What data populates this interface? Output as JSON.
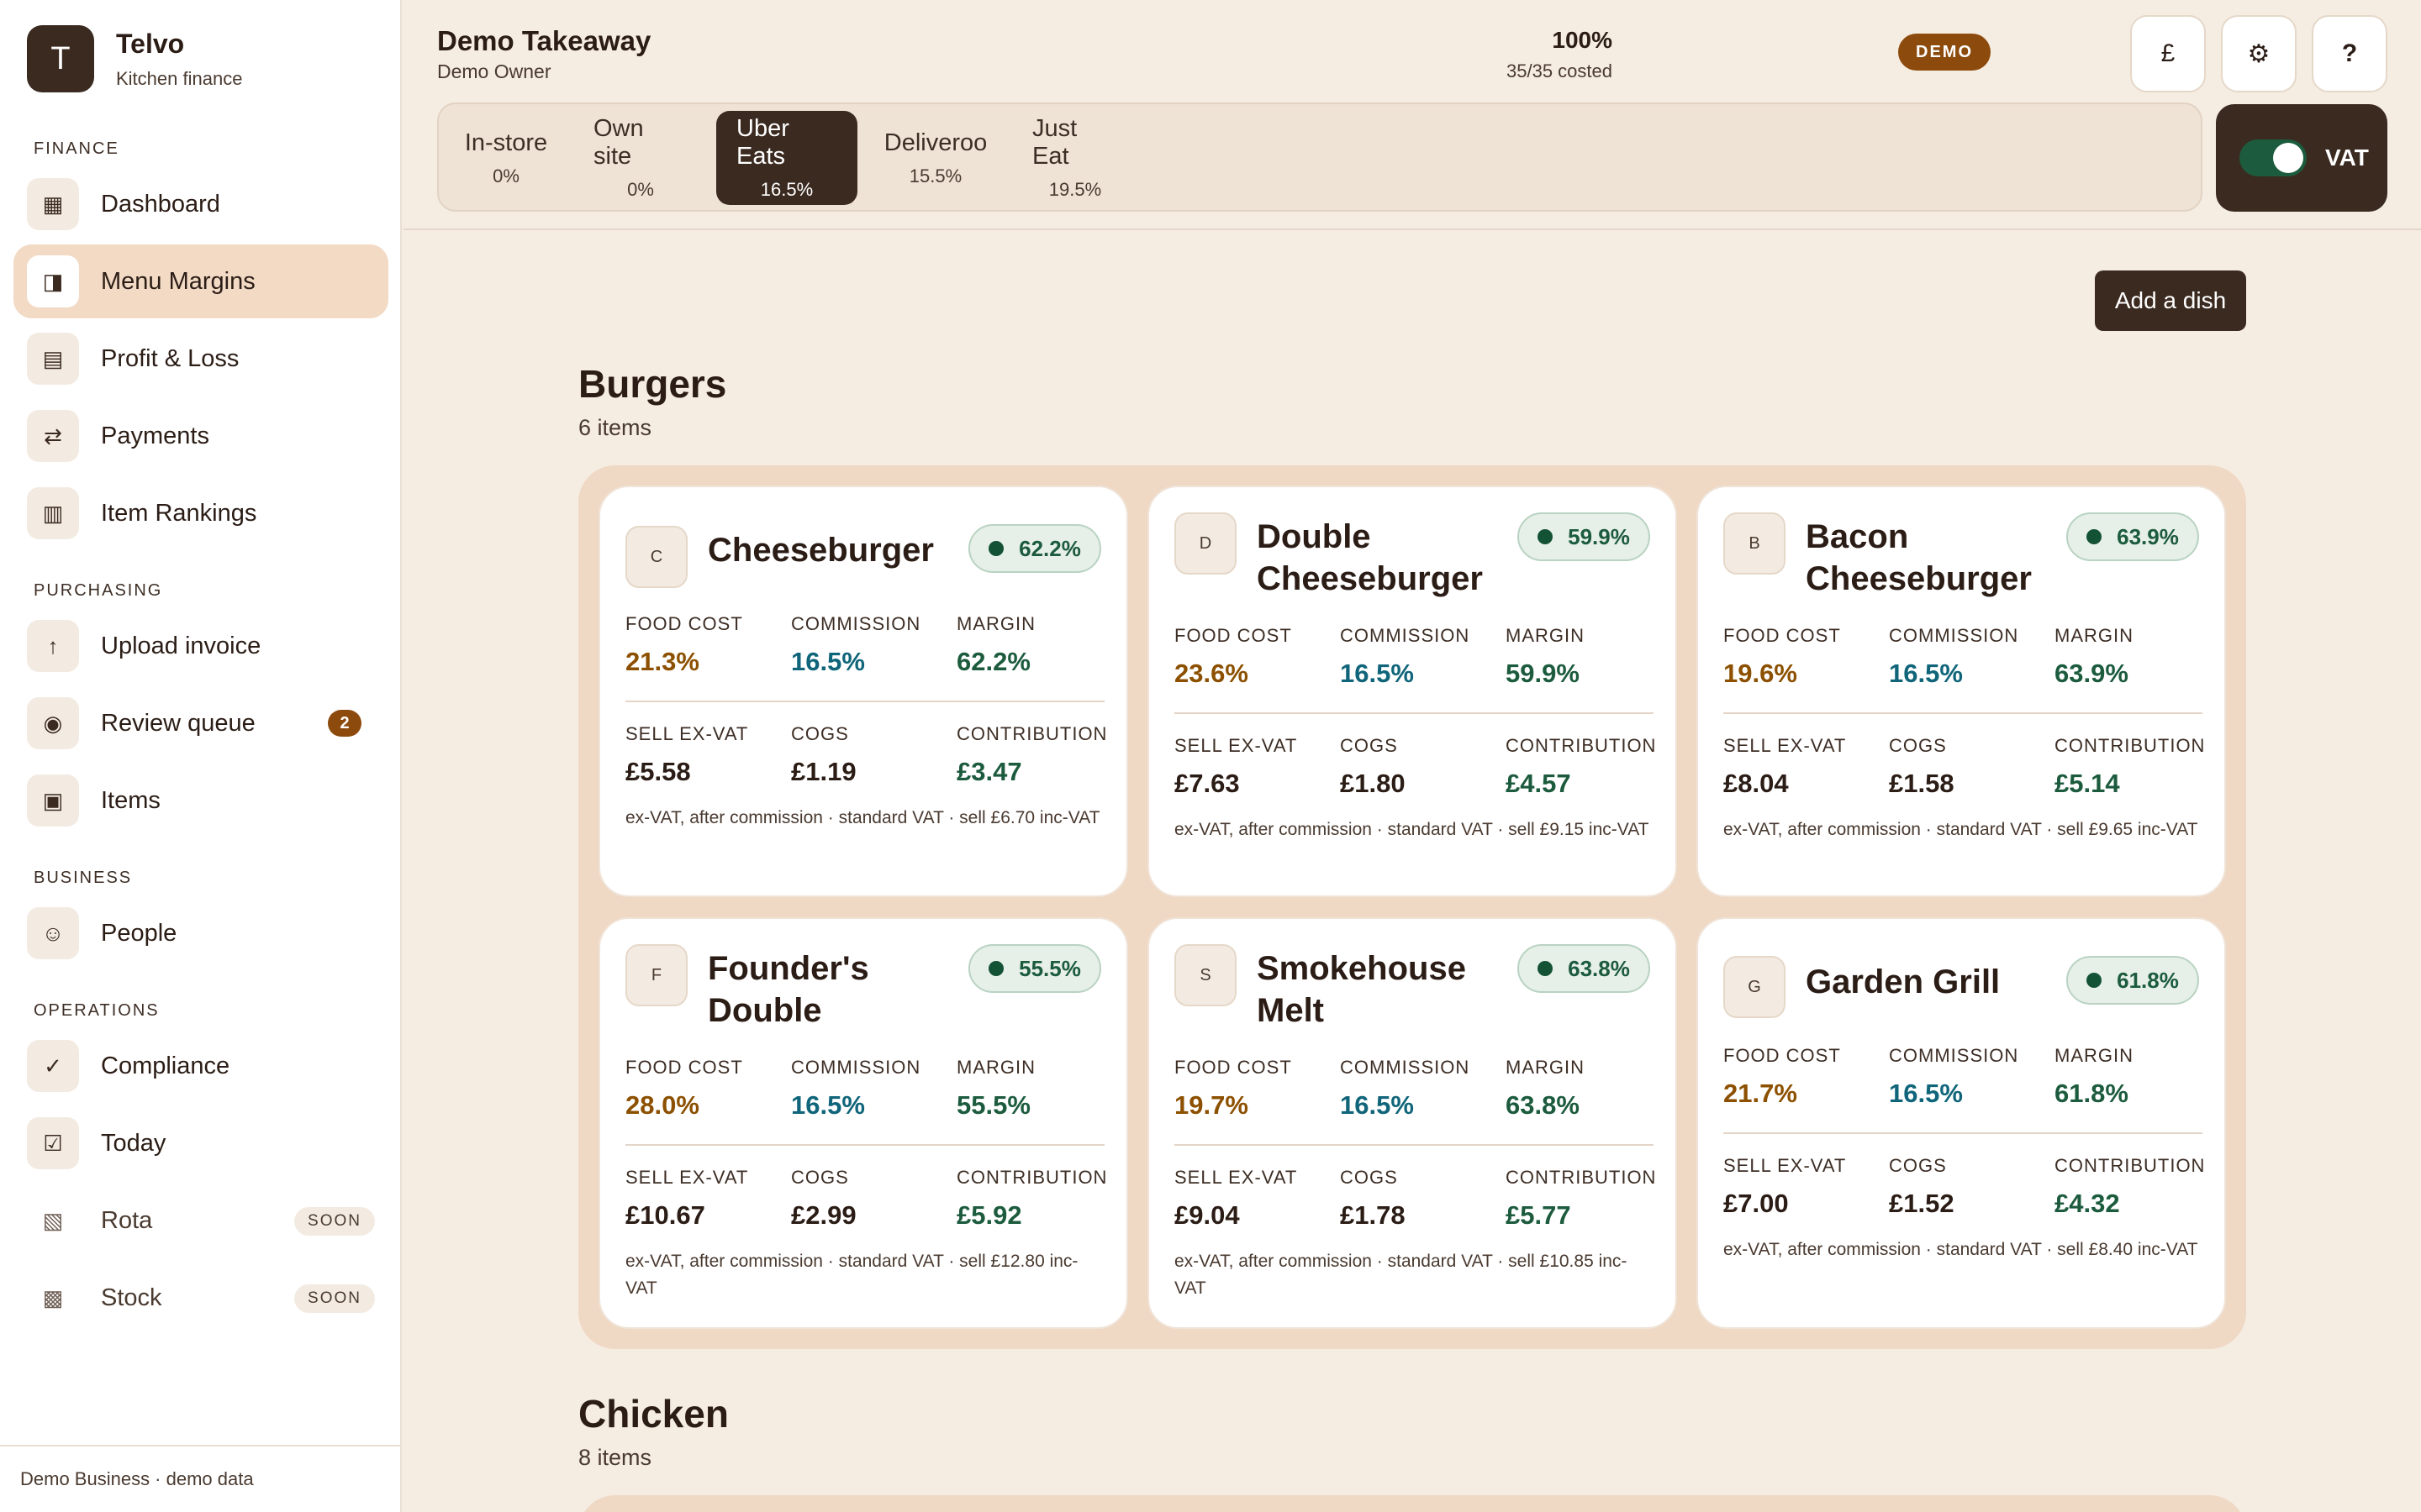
{
  "brand": {
    "initial": "T",
    "name": "Telvo",
    "subtitle": "Kitchen finance"
  },
  "sidebar": {
    "sections": {
      "finance": "FINANCE",
      "purchasing": "PURCHASING",
      "business": "BUSINESS",
      "operations": "OPERATIONS"
    },
    "items": [
      {
        "label": "Dashboard",
        "icon": "▦"
      },
      {
        "label": "Menu Margins",
        "icon": "◨"
      },
      {
        "label": "Profit & Loss",
        "icon": "▤"
      },
      {
        "label": "Payments",
        "icon": "⇄"
      },
      {
        "label": "Item Rankings",
        "icon": "▥"
      },
      {
        "label": "Upload invoice",
        "icon": "↑"
      },
      {
        "label": "Review queue",
        "icon": "◉",
        "badge": "2"
      },
      {
        "label": "Items",
        "icon": "▣"
      },
      {
        "label": "People",
        "icon": "☺"
      },
      {
        "label": "Compliance",
        "icon": "✓"
      },
      {
        "label": "Today",
        "icon": "☑"
      },
      {
        "label": "Rota",
        "icon": "▧",
        "badge": "SOON"
      },
      {
        "label": "Stock",
        "icon": "▩",
        "badge": "SOON"
      }
    ],
    "footer": "Demo Business · demo data"
  },
  "header": {
    "business": "Demo Takeaway",
    "owner": "Demo Owner",
    "demo_badge": "DEMO",
    "costed_pct": "100%",
    "costed_sub": "35/35 costed",
    "buttons": {
      "currency": "£",
      "settings": "⚙",
      "help": "?"
    },
    "vat_label": "VAT",
    "vat_on": true
  },
  "channels": [
    {
      "name": "In-store",
      "pct": "0%"
    },
    {
      "name": "Own site",
      "pct": "0%"
    },
    {
      "name": "Uber Eats",
      "pct": "16.5%",
      "active": true
    },
    {
      "name": "Deliveroo",
      "pct": "15.5%"
    },
    {
      "name": "Just Eat",
      "pct": "19.5%"
    }
  ],
  "main": {
    "add_dish": "Add a dish",
    "labels": {
      "food_cost": "FOOD COST",
      "commission": "COMMISSION",
      "margin": "MARGIN",
      "sell": "SELL EX-VAT",
      "cogs": "COGS",
      "contribution": "CONTRIBUTION"
    },
    "sections": [
      {
        "title": "Burgers",
        "count": "6 items",
        "dishes": [
          {
            "initial": "C",
            "name": "Cheeseburger",
            "margin_badge": "62.2%",
            "food_cost": "21.3%",
            "commission": "16.5%",
            "margin": "62.2%",
            "sell": "£5.58",
            "cogs": "£1.19",
            "contribution": "£3.47",
            "note": "ex-VAT, after commission · standard VAT · sell £6.70 inc-VAT"
          },
          {
            "initial": "D",
            "name": "Double Cheeseburger",
            "margin_badge": "59.9%",
            "food_cost": "23.6%",
            "commission": "16.5%",
            "margin": "59.9%",
            "sell": "£7.63",
            "cogs": "£1.80",
            "contribution": "£4.57",
            "note": "ex-VAT, after commission · standard VAT · sell £9.15 inc-VAT"
          },
          {
            "initial": "B",
            "name": "Bacon Cheeseburger",
            "margin_badge": "63.9%",
            "food_cost": "19.6%",
            "commission": "16.5%",
            "margin": "63.9%",
            "sell": "£8.04",
            "cogs": "£1.58",
            "contribution": "£5.14",
            "note": "ex-VAT, after commission · standard VAT · sell £9.65 inc-VAT"
          },
          {
            "initial": "F",
            "name": "Founder's Double",
            "margin_badge": "55.5%",
            "food_cost": "28.0%",
            "commission": "16.5%",
            "margin": "55.5%",
            "sell": "£10.67",
            "cogs": "£2.99",
            "contribution": "£5.92",
            "note": "ex-VAT, after commission · standard VAT · sell £12.80 inc-VAT"
          },
          {
            "initial": "S",
            "name": "Smokehouse Melt",
            "margin_badge": "63.8%",
            "food_cost": "19.7%",
            "commission": "16.5%",
            "margin": "63.8%",
            "sell": "£9.04",
            "cogs": "£1.78",
            "contribution": "£5.77",
            "note": "ex-VAT, after commission · standard VAT · sell £10.85 inc-VAT"
          },
          {
            "initial": "G",
            "name": "Garden Grill",
            "margin_badge": "61.8%",
            "food_cost": "21.7%",
            "commission": "16.5%",
            "margin": "61.8%",
            "sell": "£7.00",
            "cogs": "£1.52",
            "contribution": "£4.32",
            "note": "ex-VAT, after commission · standard VAT · sell £8.40 inc-VAT"
          }
        ]
      },
      {
        "title": "Chicken",
        "count": "8 items"
      }
    ]
  },
  "colors": {
    "accent_dark": "#3b2a20",
    "demo_badge": "#8c4a0d",
    "food_cost": "#8c5000",
    "commission": "#10657a",
    "margin": "#1c5b3d",
    "active_nav": "#f2dac5"
  }
}
